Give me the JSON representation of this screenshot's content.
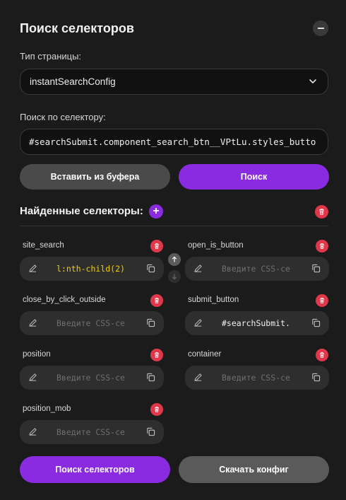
{
  "header": {
    "title": "Поиск селекторов"
  },
  "page_type": {
    "label": "Тип страницы:",
    "selected": "instantSearchConfig"
  },
  "selector_search": {
    "label": "Поиск по селектору:",
    "value": "#searchSubmit.component_search_btn__VPtLu.styles_butto"
  },
  "actions": {
    "paste_label": "Вставить из буфера",
    "search_label": "Поиск"
  },
  "found": {
    "title": "Найденные селекторы:"
  },
  "fields": [
    {
      "name": "site_search",
      "value": "l:nth-child(2)",
      "placeholder": "Введите CSS-се"
    },
    {
      "name": "open_is_button",
      "value": "",
      "placeholder": "Введите CSS-се"
    },
    {
      "name": "close_by_click_outside",
      "value": "",
      "placeholder": "Введите CSS-се"
    },
    {
      "name": "submit_button",
      "value": "#searchSubmit.",
      "placeholder": "Введите CSS-се"
    },
    {
      "name": "position",
      "value": "",
      "placeholder": "Введите CSS-се"
    },
    {
      "name": "container",
      "value": "",
      "placeholder": "Введите CSS-се"
    },
    {
      "name": "position_mob",
      "value": "",
      "placeholder": "Введите CSS-се"
    }
  ],
  "footer": {
    "find_label": "Поиск селекторов",
    "download_label": "Скачать конфиг"
  },
  "colors": {
    "accent": "#8a2be2",
    "danger": "#e0384a",
    "highlight": "#f0d000"
  }
}
